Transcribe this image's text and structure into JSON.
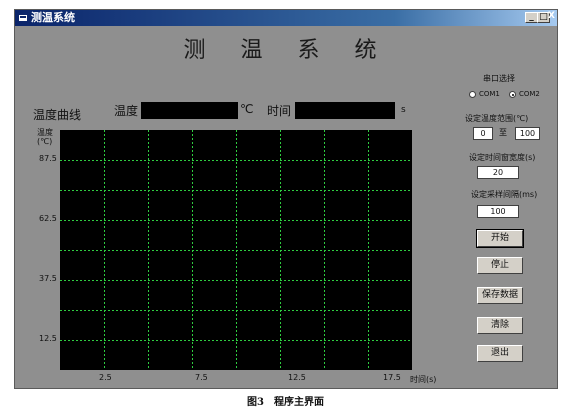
{
  "window": {
    "title": "测温系统"
  },
  "titlebar_buttons": {
    "minimize": "_",
    "maximize": "□",
    "close": "X"
  },
  "header": {
    "title": "测 温 系 统"
  },
  "readout": {
    "curve_label": "温度曲线",
    "temp_label": "温度",
    "temp_unit": "℃",
    "time_label": "时间",
    "time_unit": "s"
  },
  "chart_data": {
    "type": "line",
    "ylabel": "温度\n(℃)",
    "xlabel": "时间(s)",
    "yticks": [
      "87.5",
      "62.5",
      "37.5",
      "12.5"
    ],
    "xticks": [
      "2.5",
      "7.5",
      "12.5",
      "17.5"
    ],
    "grid": true,
    "series": []
  },
  "panel": {
    "serial_label": "串口选择",
    "com1_label": "COM1",
    "com2_label": "COM2",
    "com2_selected": true,
    "temp_range_label": "设定温度范围(℃)",
    "temp_min": "0",
    "range_to": "至",
    "temp_max": "100",
    "time_width_label": "设定时间窗宽度(s)",
    "time_width": "20",
    "sample_label": "设定采样间隔(ms)",
    "sample_interval": "100",
    "buttons": {
      "start": "开始",
      "stop": "停止",
      "save": "保存数据",
      "clear": "清除",
      "exit": "退出"
    }
  },
  "caption": "图3　程序主界面"
}
